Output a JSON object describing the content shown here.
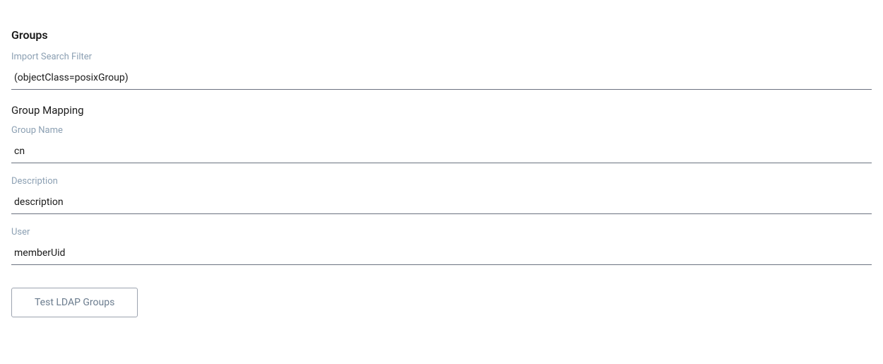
{
  "groups": {
    "header": "Groups",
    "filter_label": "Import Search Filter",
    "filter_value": "(objectClass=posixGroup)"
  },
  "mapping": {
    "header": "Group Mapping",
    "name_label": "Group Name",
    "name_value": "cn",
    "description_label": "Description",
    "description_value": "description",
    "user_label": "User",
    "user_value": "memberUid"
  },
  "actions": {
    "test_label": "Test LDAP Groups"
  }
}
